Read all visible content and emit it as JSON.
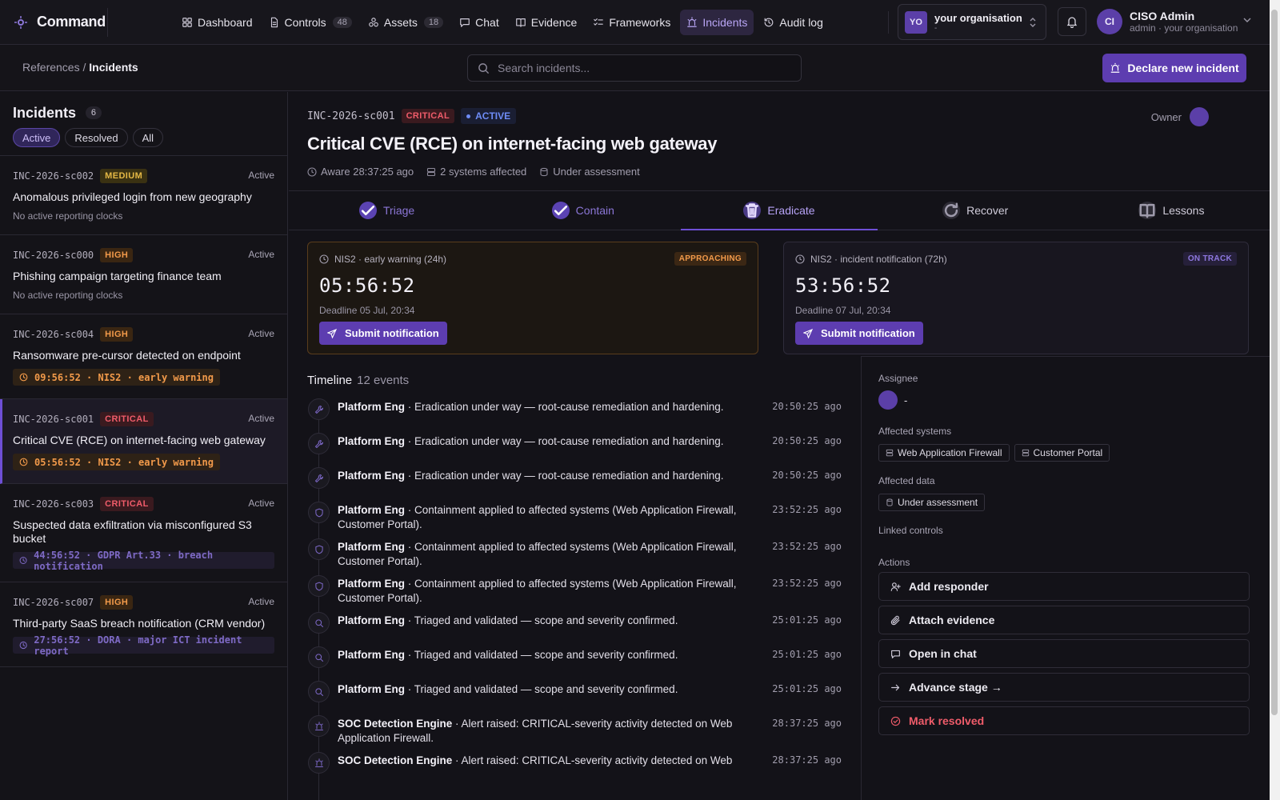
{
  "app": {
    "name": "Command"
  },
  "nav": [
    {
      "label": "Dashboard",
      "icon": "dashboard-icon"
    },
    {
      "label": "Controls",
      "badge": "48",
      "icon": "document-icon"
    },
    {
      "label": "Assets",
      "badge": "18",
      "icon": "assets-icon"
    },
    {
      "label": "Chat",
      "icon": "chat-icon"
    },
    {
      "label": "Evidence",
      "icon": "book-icon"
    },
    {
      "label": "Frameworks",
      "icon": "checklist-icon"
    },
    {
      "label": "Incidents",
      "icon": "siren-icon",
      "active": true
    },
    {
      "label": "Audit log",
      "icon": "history-icon"
    }
  ],
  "org": {
    "avatar": "YO",
    "name": "your organisation",
    "sub": "-"
  },
  "user": {
    "avatar": "CI",
    "name": "CISO Admin",
    "role": "admin · your organisation"
  },
  "breadcrumb": {
    "parent": "References",
    "sep": " / ",
    "current": "Incidents"
  },
  "search": {
    "placeholder": "Search incidents..."
  },
  "declare_button": "Declare new incident",
  "sidebar": {
    "title": "Incidents",
    "count": "6",
    "filters": [
      "Active",
      "Resolved",
      "All"
    ],
    "active_filter": "Active",
    "items": [
      {
        "id": "INC-2026-sc002",
        "severity": "MEDIUM",
        "status": "Active",
        "title": "Anomalous privileged login from new geography",
        "sub": "No active reporting clocks"
      },
      {
        "id": "INC-2026-sc000",
        "severity": "HIGH",
        "status": "Active",
        "title": "Phishing campaign targeting finance team",
        "sub": "No active reporting clocks"
      },
      {
        "id": "INC-2026-sc004",
        "severity": "HIGH",
        "status": "Active",
        "title": "Ransomware pre-cursor detected on endpoint",
        "clock": "09:56:52 · NIS2 · early warning",
        "clock_tone": "warn"
      },
      {
        "id": "INC-2026-sc001",
        "severity": "CRITICAL",
        "status": "Active",
        "title": "Critical CVE (RCE) on internet-facing web gateway",
        "clock": "05:56:52 · NIS2 · early warning",
        "clock_tone": "warn",
        "selected": true
      },
      {
        "id": "INC-2026-sc003",
        "severity": "CRITICAL",
        "status": "Active",
        "title": "Suspected data exfiltration via misconfigured S3 bucket",
        "clock": "44:56:52 · GDPR Art.33 · breach notification",
        "clock_tone": "ok"
      },
      {
        "id": "INC-2026-sc007",
        "severity": "HIGH",
        "status": "Active",
        "title": "Third-party SaaS breach notification (CRM vendor)",
        "clock": "27:56:52 · DORA · major ICT incident report",
        "clock_tone": "ok"
      }
    ]
  },
  "incident": {
    "id": "INC-2026-sc001",
    "severity": "CRITICAL",
    "status": "ACTIVE",
    "title": "Critical CVE (RCE) on internet-facing web gateway",
    "meta": {
      "aware": "Aware 28:37:25 ago",
      "systems": "2 systems affected",
      "assessment": "Under assessment"
    },
    "owner_label": "Owner"
  },
  "stages": [
    {
      "label": "Triage",
      "state": "done"
    },
    {
      "label": "Contain",
      "state": "done"
    },
    {
      "label": "Eradicate",
      "state": "current"
    },
    {
      "label": "Recover",
      "state": "todo"
    },
    {
      "label": "Lessons",
      "state": "todo"
    }
  ],
  "clocks": [
    {
      "title": "NIS2 · early warning (24h)",
      "badge": "APPROACHING",
      "time": "05:56:52",
      "deadline": "Deadline 05 Jul, 20:34",
      "button": "Submit notification"
    },
    {
      "title": "NIS2 · incident notification (72h)",
      "badge": "ON TRACK",
      "time": "53:56:52",
      "deadline": "Deadline 07 Jul, 20:34",
      "button": "Submit notification"
    }
  ],
  "timeline": {
    "title": "Timeline",
    "count": "12 events",
    "events": [
      {
        "actor": "Platform Eng",
        "text": " · Eradication under way — root-cause remediation and hardening.",
        "time": "20:50:25 ago",
        "icon": "wrench-icon"
      },
      {
        "actor": "Platform Eng",
        "text": " · Eradication under way — root-cause remediation and hardening.",
        "time": "20:50:25 ago",
        "icon": "wrench-icon"
      },
      {
        "actor": "Platform Eng",
        "text": " · Eradication under way — root-cause remediation and hardening.",
        "time": "20:50:25 ago",
        "icon": "wrench-icon"
      },
      {
        "actor": "Platform Eng",
        "text": " · Containment applied to affected systems (Web Application Firewall, Customer Portal).",
        "time": "23:52:25 ago",
        "icon": "shield-icon"
      },
      {
        "actor": "Platform Eng",
        "text": " · Containment applied to affected systems (Web Application Firewall, Customer Portal).",
        "time": "23:52:25 ago",
        "icon": "shield-icon"
      },
      {
        "actor": "Platform Eng",
        "text": " · Containment applied to affected systems (Web Application Firewall, Customer Portal).",
        "time": "23:52:25 ago",
        "icon": "shield-icon"
      },
      {
        "actor": "Platform Eng",
        "text": " · Triaged and validated — scope and severity confirmed.",
        "time": "25:01:25 ago",
        "icon": "search-icon"
      },
      {
        "actor": "Platform Eng",
        "text": " · Triaged and validated — scope and severity confirmed.",
        "time": "25:01:25 ago",
        "icon": "search-icon"
      },
      {
        "actor": "Platform Eng",
        "text": " · Triaged and validated — scope and severity confirmed.",
        "time": "25:01:25 ago",
        "icon": "search-icon"
      },
      {
        "actor": "SOC Detection Engine",
        "text": " · Alert raised: CRITICAL-severity activity detected on Web Application Firewall.",
        "time": "28:37:25 ago",
        "icon": "siren-icon"
      },
      {
        "actor": "SOC Detection Engine",
        "text": " · Alert raised: CRITICAL-severity activity detected on Web",
        "time": "28:37:25 ago",
        "icon": "siren-icon"
      }
    ]
  },
  "panel": {
    "assignee_label": "Assignee",
    "assignee_value": "-",
    "affected_systems_label": "Affected systems",
    "affected_systems": [
      "Web Application Firewall",
      "Customer Portal"
    ],
    "affected_data_label": "Affected data",
    "affected_data": [
      "Under assessment"
    ],
    "linked_controls_label": "Linked controls",
    "actions_label": "Actions",
    "actions": [
      {
        "label": "Add responder",
        "icon": "user-plus-icon"
      },
      {
        "label": "Attach evidence",
        "icon": "paperclip-icon"
      },
      {
        "label": "Open in chat",
        "icon": "chat-icon"
      },
      {
        "label": "Advance stage →",
        "icon": "arrow-right-icon"
      },
      {
        "label": "Mark resolved",
        "icon": "check-circle-icon",
        "danger": true
      }
    ]
  },
  "colors": {
    "accent": "#5d3db0",
    "critical": "#f05c6a",
    "high": "#f29a4a",
    "medium": "#e5b845",
    "active_blue": "#6e8cf6"
  }
}
